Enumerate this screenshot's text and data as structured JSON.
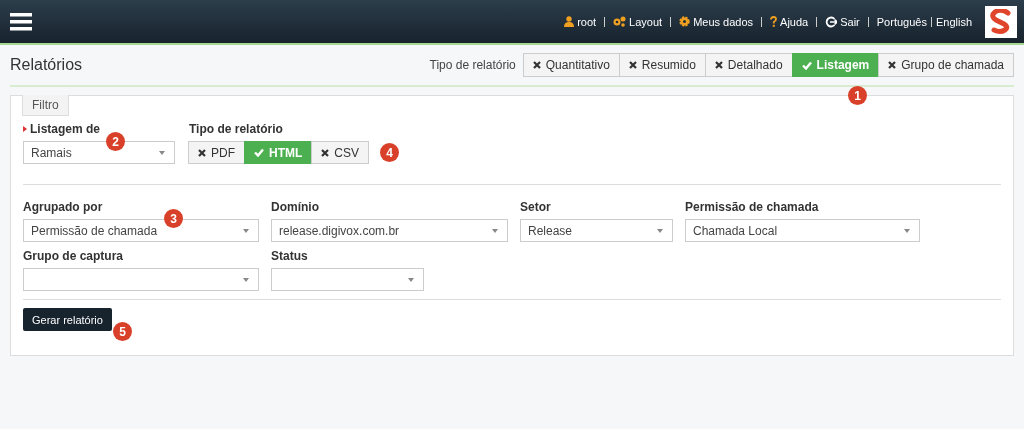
{
  "header": {
    "menu": [
      {
        "kind": "user",
        "label": "root"
      },
      {
        "kind": "layout",
        "label": "Layout"
      },
      {
        "kind": "gear",
        "label": "Meus dados"
      },
      {
        "kind": "help",
        "label": "Ajuda"
      },
      {
        "kind": "logout",
        "label": "Sair"
      }
    ],
    "languages": [
      "Português",
      "English"
    ]
  },
  "page_title": "Relatórios",
  "report_type": {
    "label": "Tipo de relatório",
    "options": [
      {
        "label": "Quantitativo",
        "selected": false
      },
      {
        "label": "Resumido",
        "selected": false
      },
      {
        "label": "Detalhado",
        "selected": false
      },
      {
        "label": "Listagem",
        "selected": true
      },
      {
        "label": "Grupo de chamada",
        "selected": false
      }
    ]
  },
  "filter_tab": "Filtro",
  "listing": {
    "label": "Listagem de",
    "value": "Ramais"
  },
  "format": {
    "label": "Tipo de relatório",
    "options": [
      {
        "label": "PDF",
        "selected": false
      },
      {
        "label": "HTML",
        "selected": true
      },
      {
        "label": "CSV",
        "selected": false
      }
    ]
  },
  "fields": [
    [
      {
        "label": "Agrupado por",
        "value": "Permissão de chamada"
      },
      {
        "label": "Domínio",
        "value": "release.digivox.com.br"
      },
      {
        "label": "Setor",
        "value": "Release"
      },
      {
        "label": "Permissão de chamada",
        "value": "Chamada Local"
      }
    ],
    [
      {
        "label": "Grupo de captura"
      },
      {
        "label": "Status"
      }
    ]
  ],
  "submit": "Gerar relatório",
  "callouts": [
    "1",
    "2",
    "3",
    "4",
    "5"
  ]
}
